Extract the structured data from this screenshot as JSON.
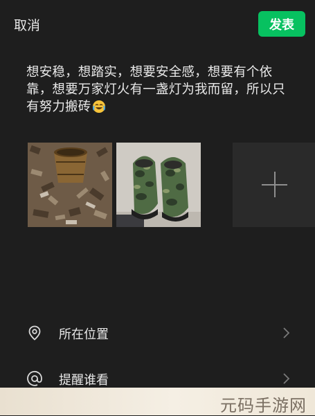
{
  "header": {
    "cancel_label": "取消",
    "publish_label": "发表"
  },
  "post": {
    "text": " 想安稳，想踏实，想要安全感，想要有个依靠，想要万家灯火有一盏灯为我而留，所以只有努力搬砖",
    "emoji": "crying-laughing-emoji"
  },
  "photos": [
    {
      "icon": "photo-wooden-bucket-on-scraps"
    },
    {
      "icon": "photo-camouflage-boots"
    }
  ],
  "add_photo": {
    "icon": "plus-icon"
  },
  "menu": [
    {
      "label": "所在位置",
      "icon": "location-pin-icon"
    },
    {
      "label": "提醒谁看",
      "icon": "at-sign-icon"
    }
  ],
  "watermark": {
    "text": "元码手游网"
  },
  "colors": {
    "accent": "#07c160",
    "background": "#1e1e1e"
  }
}
